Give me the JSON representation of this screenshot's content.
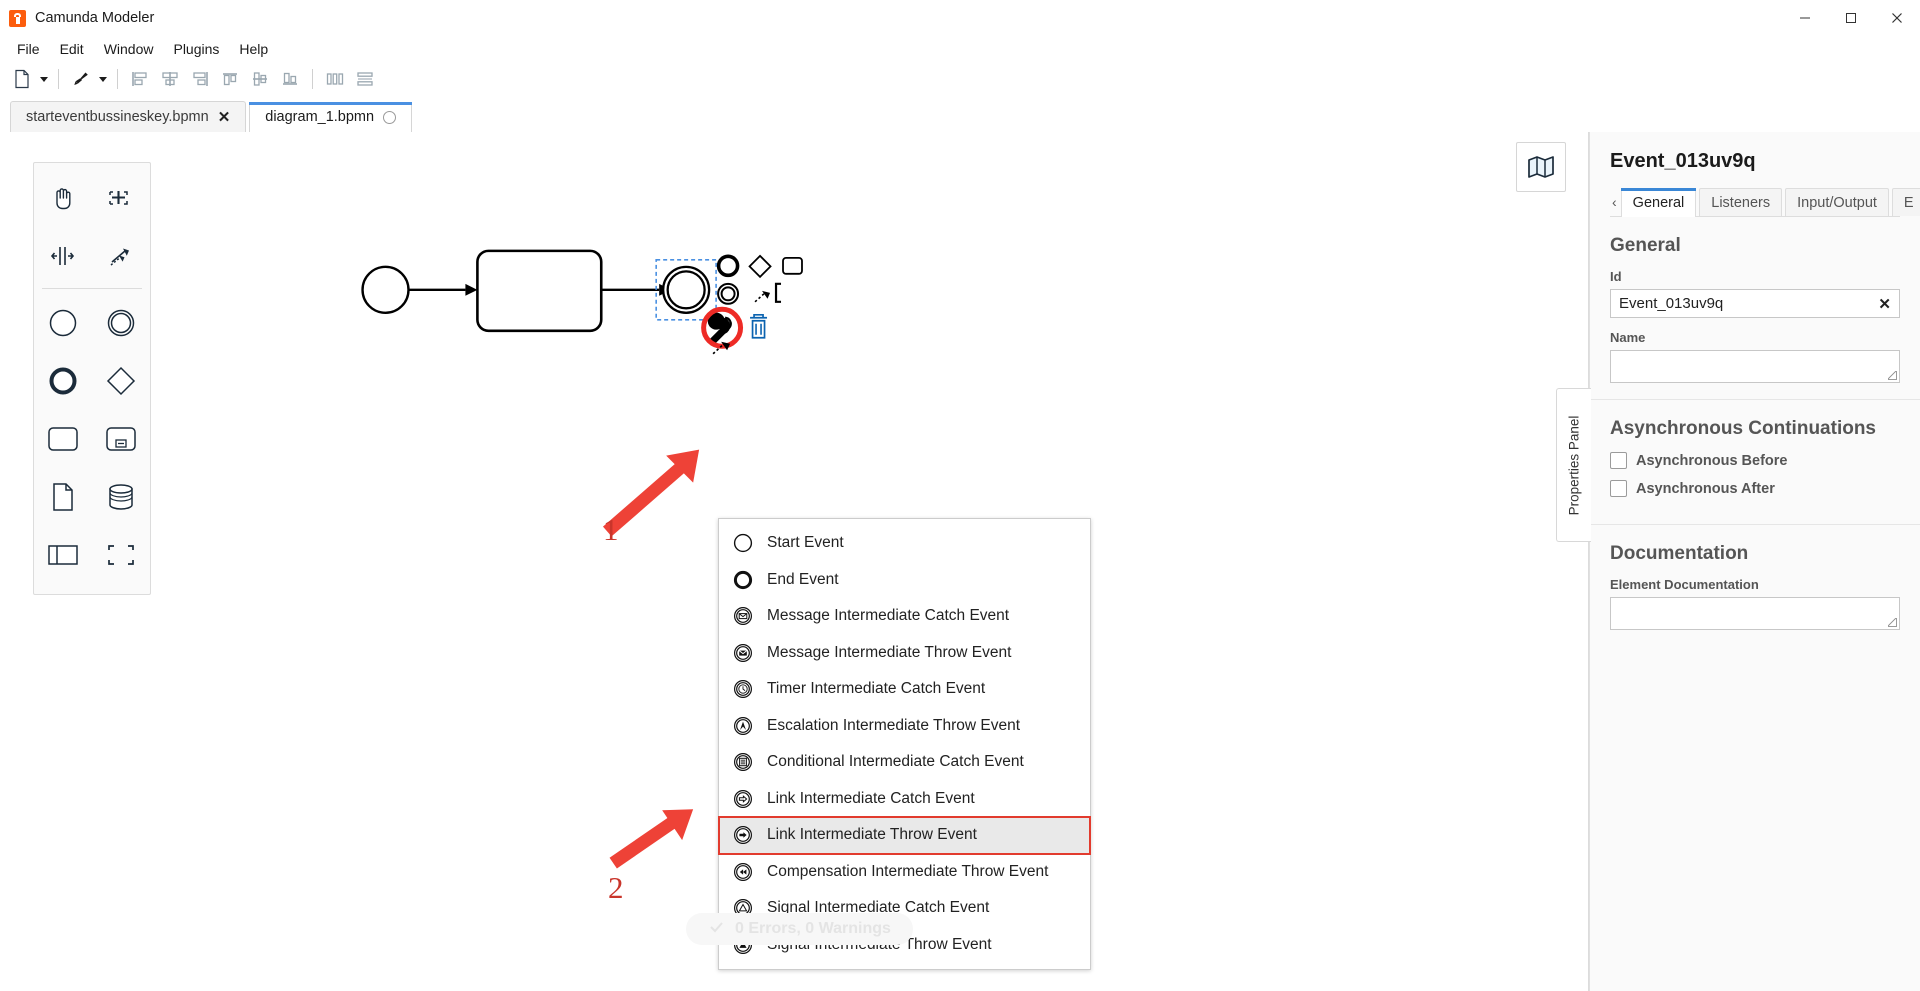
{
  "window": {
    "title": "Camunda Modeler",
    "app_icon": "camunda-logo-icon",
    "minimize": "minimize-icon",
    "maximize": "maximize-icon",
    "close": "close-icon"
  },
  "menubar": {
    "items": [
      "File",
      "Edit",
      "Window",
      "Plugins",
      "Help"
    ]
  },
  "toolbar": {
    "buttons": [
      {
        "name": "new-file-icon",
        "caret": true
      },
      {
        "name": "deploy-brush-icon",
        "caret": true
      },
      {
        "name": "align-left-icon",
        "caret": false
      },
      {
        "name": "align-center-icon",
        "caret": false
      },
      {
        "name": "align-right-icon",
        "caret": false
      },
      {
        "name": "align-top-icon",
        "caret": false
      },
      {
        "name": "align-middle-icon",
        "caret": false
      },
      {
        "name": "align-bottom-icon",
        "caret": false
      },
      {
        "name": "distribute-horizontal-icon",
        "caret": false
      },
      {
        "name": "distribute-vertical-icon",
        "caret": false
      }
    ]
  },
  "tabs": [
    {
      "label": "starteventbussineskey.bpmn",
      "active": false,
      "indicator": "close"
    },
    {
      "label": "diagram_1.bpmn",
      "active": true,
      "indicator": "dot"
    }
  ],
  "palette": {
    "tools": [
      "hand-tool-icon",
      "lasso-tool-icon",
      "space-tool-icon",
      "global-connect-tool-icon"
    ],
    "elements": [
      "start-event-icon",
      "intermediate-event-icon",
      "end-event-icon",
      "gateway-icon",
      "task-icon",
      "subprocess-icon",
      "data-object-icon",
      "data-store-icon",
      "participant-icon",
      "group-icon"
    ]
  },
  "canvas": {
    "minimap_button": "minimap-icon",
    "elements": [
      {
        "type": "start-event",
        "label": ""
      },
      {
        "type": "task",
        "label": ""
      },
      {
        "type": "end-event",
        "label": "",
        "selected": true
      }
    ],
    "context_pad": [
      "append-end-event-icon",
      "append-gateway-icon",
      "append-task-icon",
      "append-intermediate-event-icon",
      "append-text-annotation-icon",
      "wrench-replace-icon",
      "delete-trash-icon",
      "connect-icon"
    ]
  },
  "replace_menu": {
    "items": [
      {
        "label": "Start Event",
        "icon": "start-event-icon",
        "selected": false
      },
      {
        "label": "End Event",
        "icon": "end-event-icon",
        "selected": false
      },
      {
        "label": "Message Intermediate Catch Event",
        "icon": "message-catch-icon",
        "selected": false
      },
      {
        "label": "Message Intermediate Throw Event",
        "icon": "message-throw-icon",
        "selected": false
      },
      {
        "label": "Timer Intermediate Catch Event",
        "icon": "timer-catch-icon",
        "selected": false
      },
      {
        "label": "Escalation Intermediate Throw Event",
        "icon": "escalation-throw-icon",
        "selected": false
      },
      {
        "label": "Conditional Intermediate Catch Event",
        "icon": "conditional-catch-icon",
        "selected": false
      },
      {
        "label": "Link Intermediate Catch Event",
        "icon": "link-catch-icon",
        "selected": false
      },
      {
        "label": "Link Intermediate Throw Event",
        "icon": "link-throw-icon",
        "selected": true
      },
      {
        "label": "Compensation Intermediate Throw Event",
        "icon": "compensation-throw-icon",
        "selected": false
      },
      {
        "label": "Signal Intermediate Catch Event",
        "icon": "signal-catch-icon",
        "selected": false
      },
      {
        "label": "Signal Intermediate Throw Event",
        "icon": "signal-throw-icon",
        "selected": false
      }
    ]
  },
  "annotations": [
    {
      "number": "1",
      "color": "#c9352b",
      "target": "wrench-replace-icon"
    },
    {
      "number": "2",
      "color": "#c9352b",
      "target": "link-intermediate-throw-event-item"
    }
  ],
  "status": {
    "check_icon": "check-icon",
    "text": "0 Errors, 0 Warnings"
  },
  "properties": {
    "collapse_tab_label": "Properties Panel",
    "element_title": "Event_013uv9q",
    "tabs": [
      {
        "label": "General",
        "active": true
      },
      {
        "label": "Listeners",
        "active": false
      },
      {
        "label": "Input/Output",
        "active": false
      },
      {
        "label": "E",
        "active": false
      }
    ],
    "tabs_more_icon": "chevron-right-icon",
    "tabs_prev_icon": "chevron-left-icon",
    "general": {
      "heading": "General",
      "id_label": "Id",
      "id_value": "Event_013uv9q",
      "id_clear": "✕",
      "name_label": "Name",
      "name_value": ""
    },
    "async": {
      "heading": "Asynchronous Continuations",
      "before_label": "Asynchronous Before",
      "before_checked": false,
      "after_label": "Asynchronous After",
      "after_checked": false
    },
    "documentation": {
      "heading": "Documentation",
      "label": "Element Documentation",
      "value": ""
    }
  },
  "colors": {
    "accent": "#4a90e2",
    "brand": "#fc5d0d",
    "annotation": "#e23b2e",
    "selection": "#4a90e2"
  }
}
